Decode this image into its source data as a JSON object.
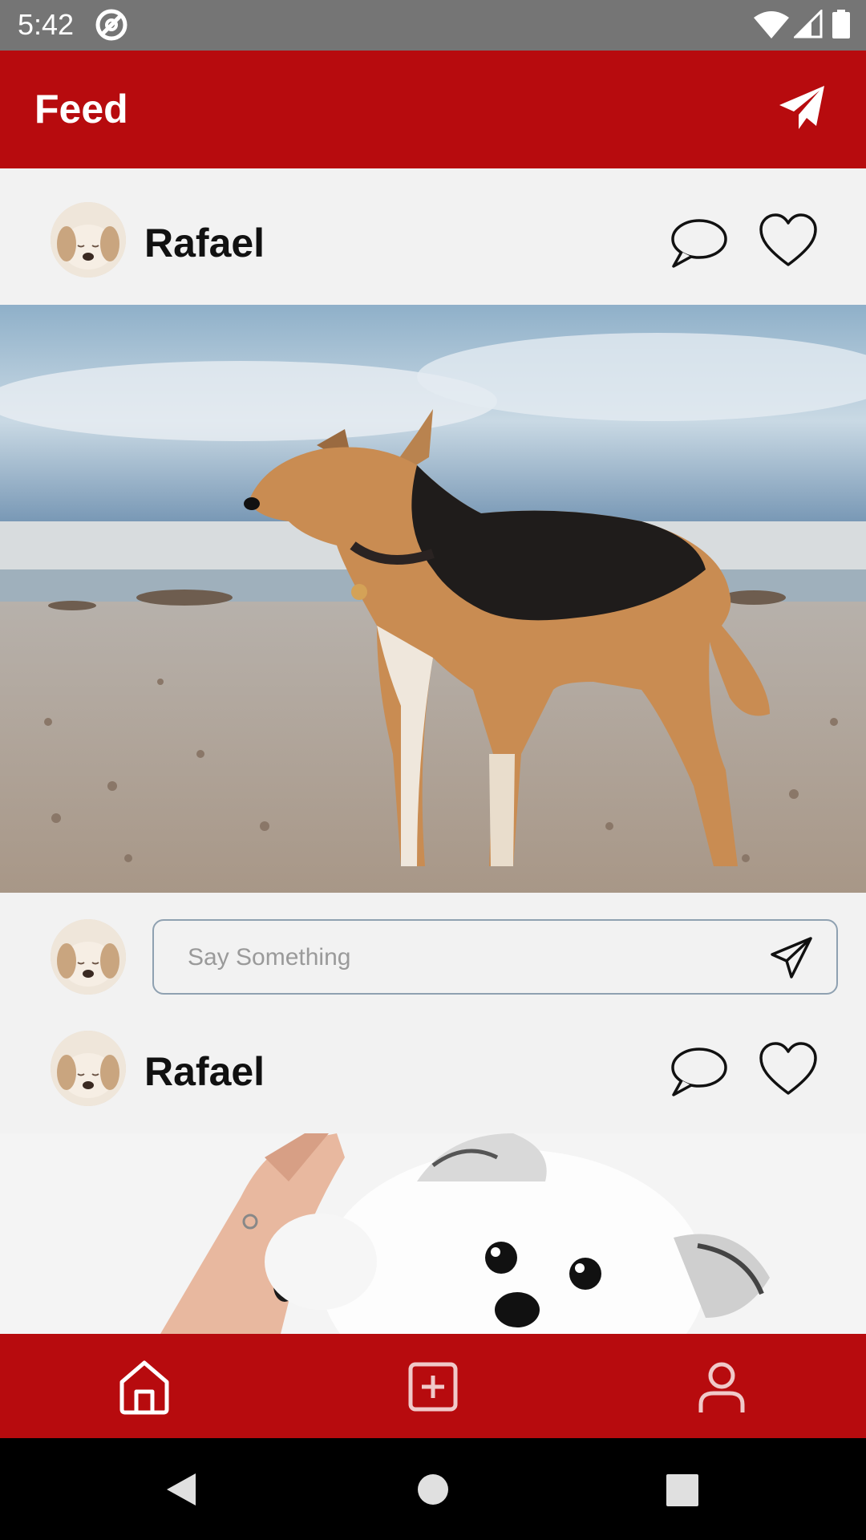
{
  "status_bar": {
    "time": "5:42",
    "icons": [
      "no-disturb-icon",
      "wifi-icon",
      "cellular-signal-icon",
      "battery-icon"
    ]
  },
  "app_bar": {
    "title": "Feed",
    "action_icon": "paper-plane-icon",
    "color": "#b70b0e"
  },
  "posts": [
    {
      "username": "Rafael",
      "avatar": "puppy-avatar",
      "actions": [
        "comment-icon",
        "heart-icon"
      ],
      "image": "dog-on-beach-photo"
    },
    {
      "username": "Rafael",
      "avatar": "puppy-avatar",
      "actions": [
        "comment-icon",
        "heart-icon"
      ],
      "image": "white-dog-high-five-photo"
    }
  ],
  "comment": {
    "placeholder": "Say Something",
    "value": "",
    "send_icon": "send-icon"
  },
  "bottom_nav": {
    "items": [
      "home-icon",
      "add-post-icon",
      "profile-icon"
    ],
    "active": "home-icon"
  },
  "system_nav": [
    "back-icon",
    "home-circle-icon",
    "recents-icon"
  ]
}
